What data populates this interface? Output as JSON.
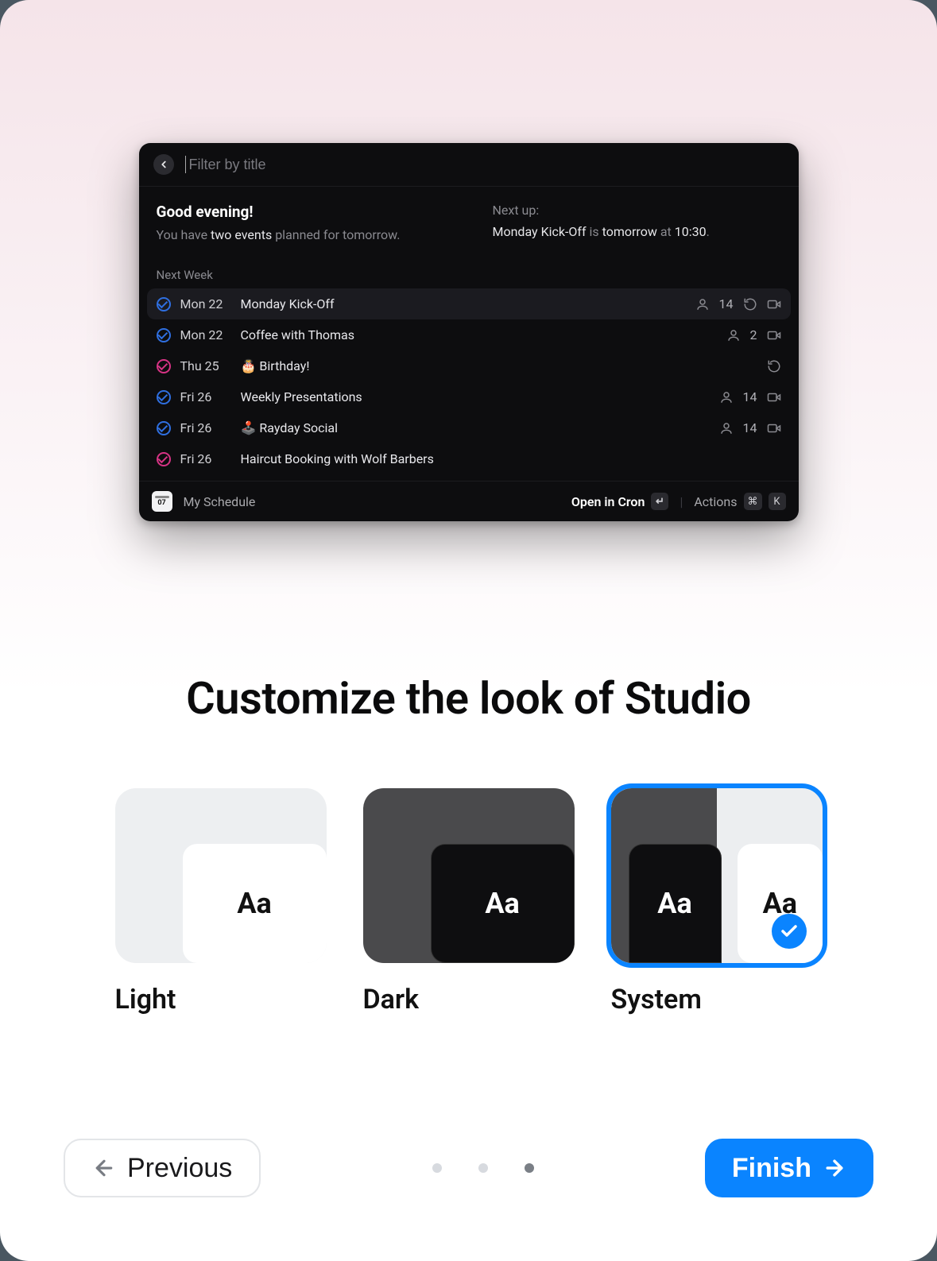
{
  "preview": {
    "filter_placeholder": "Filter by title",
    "greeting": "Good evening!",
    "summary_prefix": "You have ",
    "summary_highlight": "two events",
    "summary_suffix": " planned for tomorrow.",
    "nextup_label": "Next up:",
    "nextup_event": "Monday Kick-Off",
    "nextup_mid": " is ",
    "nextup_when": "tomorrow",
    "nextup_time_prefix": " at ",
    "nextup_time": "10:30",
    "nextup_period": ".",
    "section_label": "Next Week",
    "events": [
      {
        "color": "blue",
        "date": "Mon 22",
        "title": "Monday Kick-Off",
        "emoji": "",
        "attendees": "14",
        "recurring": true,
        "video": true,
        "selected": true
      },
      {
        "color": "blue",
        "date": "Mon 22",
        "title": "Coffee with Thomas",
        "emoji": "",
        "attendees": "2",
        "recurring": false,
        "video": true,
        "selected": false
      },
      {
        "color": "pink",
        "date": "Thu 25",
        "title": "Birthday!",
        "emoji": "🎂",
        "attendees": "",
        "recurring": true,
        "video": false,
        "selected": false
      },
      {
        "color": "blue",
        "date": "Fri 26",
        "title": "Weekly Presentations",
        "emoji": "",
        "attendees": "14",
        "recurring": false,
        "video": true,
        "selected": false
      },
      {
        "color": "blue",
        "date": "Fri 26",
        "title": "Rayday Social",
        "emoji": "🕹️",
        "attendees": "14",
        "recurring": false,
        "video": true,
        "selected": false
      },
      {
        "color": "pink",
        "date": "Fri 26",
        "title": "Haircut Booking with Wolf Barbers",
        "emoji": "",
        "attendees": "",
        "recurring": false,
        "video": false,
        "selected": false
      }
    ],
    "footer": {
      "cal_day": "07",
      "schedule_label": "My Schedule",
      "open_label": "Open in Cron",
      "enter_key": "↵",
      "actions_label": "Actions",
      "cmd_key": "⌘",
      "k_key": "K"
    }
  },
  "headline": "Customize the look of Studio",
  "themes": {
    "sample": "Aa",
    "options": [
      {
        "id": "light",
        "label": "Light",
        "selected": false
      },
      {
        "id": "dark",
        "label": "Dark",
        "selected": false
      },
      {
        "id": "system",
        "label": "System",
        "selected": true
      }
    ]
  },
  "nav": {
    "prev": "Previous",
    "next": "Finish",
    "step_count": 3,
    "active_step": 3
  }
}
